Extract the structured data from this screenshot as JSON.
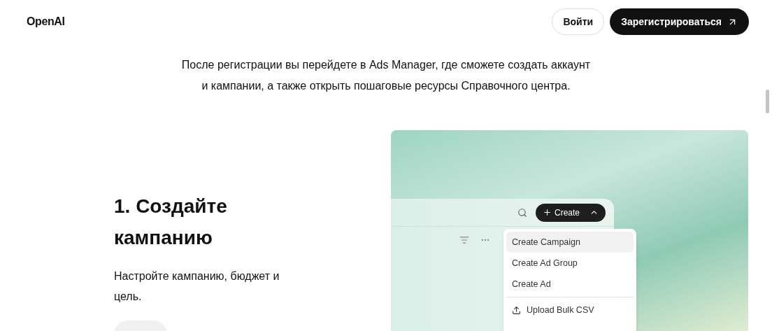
{
  "header": {
    "logo": "OpenAI",
    "login": "Войти",
    "signup": "Зарегистрироваться"
  },
  "intro": {
    "lines": [
      "После регистрации вы перейдете в Ads Manager, где сможете создать аккаунт",
      "и кампании, а также открыть пошаговые ресурсы Справочного центра."
    ]
  },
  "step": {
    "title": "1. Создайте кампанию",
    "description": "Настройте кампанию, бюджет и цель."
  },
  "preview": {
    "create_button": "Create",
    "menu_expanded": true,
    "menu": [
      {
        "label": "Create Campaign",
        "kind": "item",
        "selected": true
      },
      {
        "label": "Create Ad Group",
        "kind": "item",
        "selected": false
      },
      {
        "label": "Create Ad",
        "kind": "item",
        "selected": false
      },
      {
        "label": "Upload Bulk CSV",
        "kind": "upload",
        "selected": false
      }
    ]
  }
}
